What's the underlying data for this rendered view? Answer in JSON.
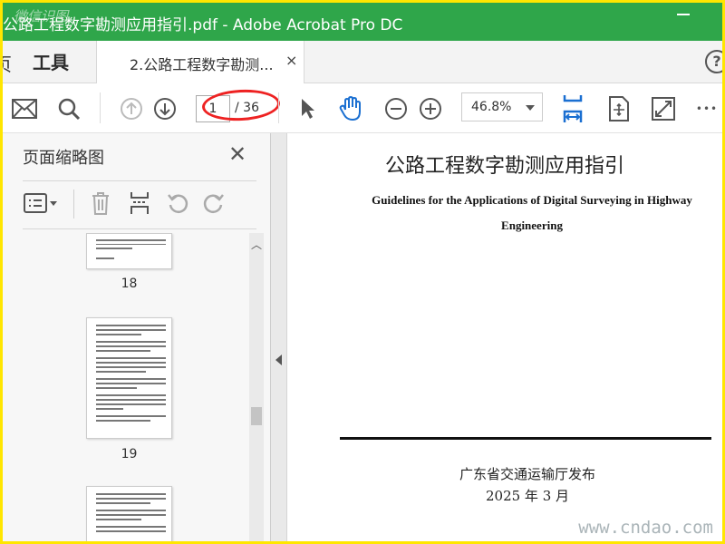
{
  "window": {
    "title": "公路工程数字勘测应用指引.pdf - Adobe Acrobat Pro DC",
    "watermark_logo": "微信识图"
  },
  "tabs": {
    "home_label": "页",
    "tools_label": "工具",
    "document_label": "2.公路工程数字勘测...",
    "close_glyph": "×",
    "help_glyph": "?"
  },
  "toolbar": {
    "current_page": "1",
    "total_pages": "/ 36",
    "zoom": "46.8%",
    "more_glyph": "•••"
  },
  "thumbnail_panel": {
    "title": "页面缩略图",
    "close_glyph": "✕",
    "pages": [
      {
        "label": "18"
      },
      {
        "label": "19"
      },
      {
        "label": ""
      }
    ]
  },
  "document": {
    "title_cn": "公路工程数字勘测应用指引",
    "title_en": "Guidelines for the Applications of Digital Surveying in Highway Engineering",
    "publisher": "广东省交通运输厅发布",
    "date": "2025 年 3 月"
  },
  "site_watermark": "www.cndao.com",
  "colors": {
    "title_bar": "#2fa64a",
    "accent_blue": "#1a6fd1",
    "annotation_red": "#e22222",
    "frame_border": "#ffe600"
  }
}
